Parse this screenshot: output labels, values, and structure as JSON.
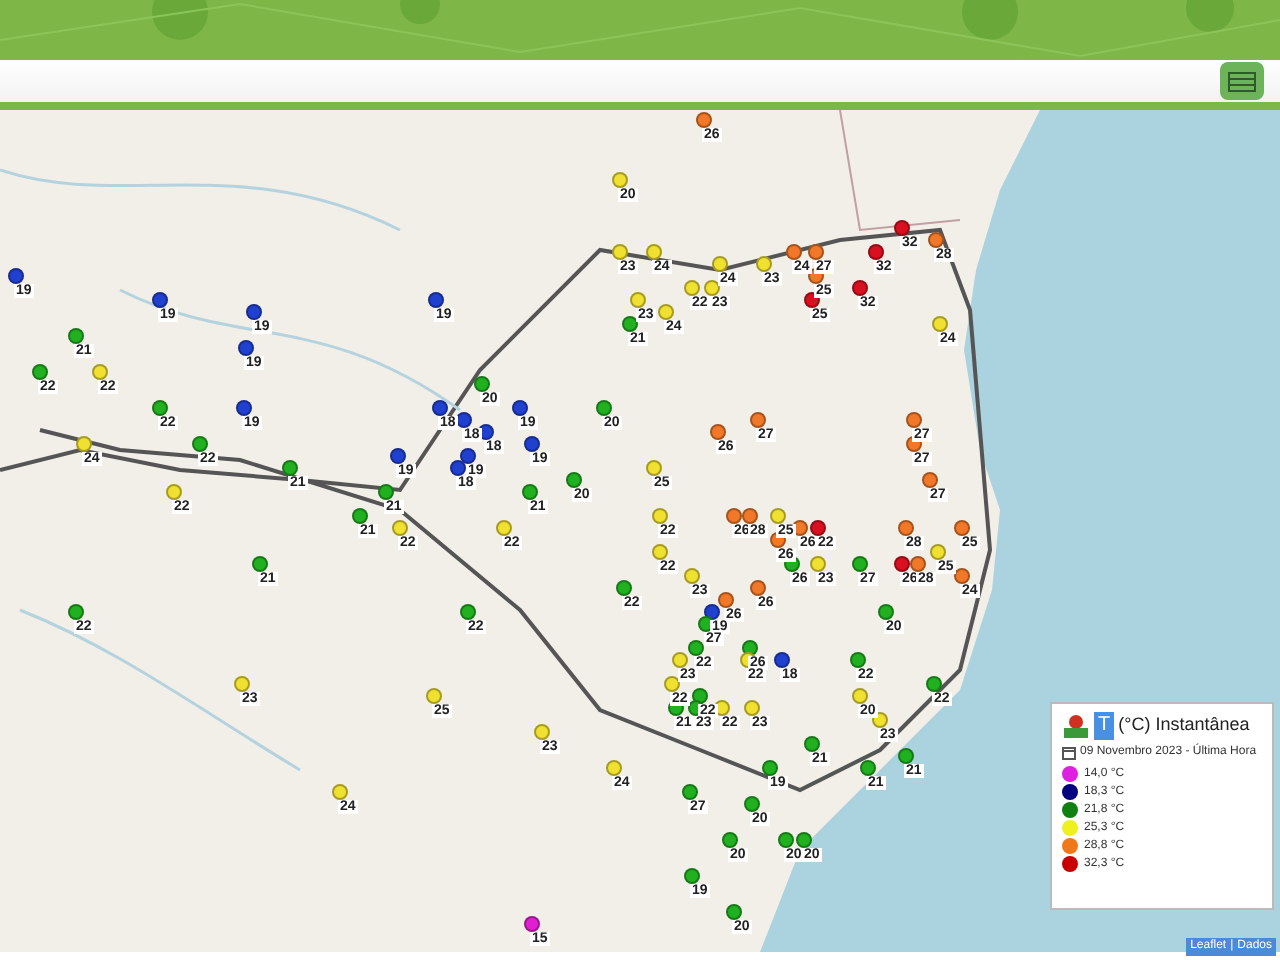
{
  "map": {
    "pins": [
      {
        "value": "26",
        "color": "#f07828"
      },
      {
        "value": "20",
        "color": "#f0e030"
      },
      {
        "value": "32",
        "color": "#d81020"
      },
      {
        "value": "28",
        "color": "#f07828"
      },
      {
        "value": "23",
        "color": "#f0e030"
      },
      {
        "value": "24",
        "color": "#f0e030"
      },
      {
        "value": "24",
        "color": "#f07828"
      },
      {
        "value": "27",
        "color": "#f07828"
      },
      {
        "value": "32",
        "color": "#d81020"
      },
      {
        "value": "24",
        "color": "#f0e030"
      },
      {
        "value": "23",
        "color": "#f0e030"
      },
      {
        "value": "19",
        "color": "#2040d0"
      },
      {
        "value": "25",
        "color": "#f07828"
      },
      {
        "value": "22",
        "color": "#f0e030"
      },
      {
        "value": "23",
        "color": "#f0e030"
      },
      {
        "value": "32",
        "color": "#d81020"
      },
      {
        "value": "19",
        "color": "#2040d0"
      },
      {
        "value": "19",
        "color": "#2040d0"
      },
      {
        "value": "23",
        "color": "#f0e030"
      },
      {
        "value": "25",
        "color": "#d81020"
      },
      {
        "value": "19",
        "color": "#2040d0"
      },
      {
        "value": "24",
        "color": "#f0e030"
      },
      {
        "value": "21",
        "color": "#20b020"
      },
      {
        "value": "24",
        "color": "#f0e030"
      },
      {
        "value": "21",
        "color": "#20b020"
      },
      {
        "value": "19",
        "color": "#2040d0"
      },
      {
        "value": "22",
        "color": "#20b020"
      },
      {
        "value": "22",
        "color": "#f0e030"
      },
      {
        "value": "20",
        "color": "#20b020"
      },
      {
        "value": "22",
        "color": "#20b020"
      },
      {
        "value": "19",
        "color": "#2040d0"
      },
      {
        "value": "18",
        "color": "#2040d0"
      },
      {
        "value": "19",
        "color": "#2040d0"
      },
      {
        "value": "20",
        "color": "#20b020"
      },
      {
        "value": "18",
        "color": "#2040d0"
      },
      {
        "value": "27",
        "color": "#f07828"
      },
      {
        "value": "27",
        "color": "#f07828"
      },
      {
        "value": "18",
        "color": "#2040d0"
      },
      {
        "value": "26",
        "color": "#f07828"
      },
      {
        "value": "24",
        "color": "#f0e030"
      },
      {
        "value": "22",
        "color": "#20b020"
      },
      {
        "value": "19",
        "color": "#2040d0"
      },
      {
        "value": "27",
        "color": "#f07828"
      },
      {
        "value": "19",
        "color": "#2040d0"
      },
      {
        "value": "19",
        "color": "#2040d0"
      },
      {
        "value": "21",
        "color": "#20b020"
      },
      {
        "value": "18",
        "color": "#2040d0"
      },
      {
        "value": "25",
        "color": "#f0e030"
      },
      {
        "value": "20",
        "color": "#20b020"
      },
      {
        "value": "27",
        "color": "#f07828"
      },
      {
        "value": "22",
        "color": "#f0e030"
      },
      {
        "value": "21",
        "color": "#20b020"
      },
      {
        "value": "21",
        "color": "#20b020"
      },
      {
        "value": "21",
        "color": "#20b020"
      },
      {
        "value": "22",
        "color": "#f0e030"
      },
      {
        "value": "26",
        "color": "#f07828"
      },
      {
        "value": "28",
        "color": "#f07828"
      },
      {
        "value": "25",
        "color": "#f0e030"
      },
      {
        "value": "22",
        "color": "#f0e030"
      },
      {
        "value": "22",
        "color": "#f0e030"
      },
      {
        "value": "26",
        "color": "#f07828"
      },
      {
        "value": "22",
        "color": "#d81020"
      },
      {
        "value": "28",
        "color": "#f07828"
      },
      {
        "value": "25",
        "color": "#f07828"
      },
      {
        "value": "26",
        "color": "#f07828"
      },
      {
        "value": "22",
        "color": "#f0e030"
      },
      {
        "value": "25",
        "color": "#f0e030"
      },
      {
        "value": "21",
        "color": "#20b020"
      },
      {
        "value": "26",
        "color": "#20b020"
      },
      {
        "value": "23",
        "color": "#f0e030"
      },
      {
        "value": "27",
        "color": "#20b020"
      },
      {
        "value": "26",
        "color": "#d81020"
      },
      {
        "value": "28",
        "color": "#f07828"
      },
      {
        "value": "23",
        "color": "#f0e030"
      },
      {
        "value": "24",
        "color": "#f07828"
      },
      {
        "value": "22",
        "color": "#20b020"
      },
      {
        "value": "26",
        "color": "#f07828"
      },
      {
        "value": "26",
        "color": "#f07828"
      },
      {
        "value": "22",
        "color": "#20b020"
      },
      {
        "value": "22",
        "color": "#20b020"
      },
      {
        "value": "19",
        "color": "#2040d0"
      },
      {
        "value": "20",
        "color": "#20b020"
      },
      {
        "value": "27",
        "color": "#20b020"
      },
      {
        "value": "22",
        "color": "#20b020"
      },
      {
        "value": "26",
        "color": "#20b020"
      },
      {
        "value": "23",
        "color": "#f0e030"
      },
      {
        "value": "22",
        "color": "#f0e030"
      },
      {
        "value": "18",
        "color": "#2040d0"
      },
      {
        "value": "22",
        "color": "#20b020"
      },
      {
        "value": "23",
        "color": "#f0e030"
      },
      {
        "value": "22",
        "color": "#f0e030"
      },
      {
        "value": "22",
        "color": "#20b020"
      },
      {
        "value": "25",
        "color": "#f0e030"
      },
      {
        "value": "22",
        "color": "#20b020"
      },
      {
        "value": "20",
        "color": "#f0e030"
      },
      {
        "value": "21",
        "color": "#20b020"
      },
      {
        "value": "23",
        "color": "#20b020"
      },
      {
        "value": "22",
        "color": "#f0e030"
      },
      {
        "value": "23",
        "color": "#f0e030"
      },
      {
        "value": "23",
        "color": "#f0e030"
      },
      {
        "value": "23",
        "color": "#f0e030"
      },
      {
        "value": "21",
        "color": "#20b020"
      },
      {
        "value": "21",
        "color": "#20b020"
      },
      {
        "value": "24",
        "color": "#f0e030"
      },
      {
        "value": "19",
        "color": "#20b020"
      },
      {
        "value": "21",
        "color": "#20b020"
      },
      {
        "value": "24",
        "color": "#f0e030"
      },
      {
        "value": "27",
        "color": "#20b020"
      },
      {
        "value": "20",
        "color": "#20b020"
      },
      {
        "value": "20",
        "color": "#20b020"
      },
      {
        "value": "20",
        "color": "#20b020"
      },
      {
        "value": "20",
        "color": "#20b020"
      },
      {
        "value": "19",
        "color": "#20b020"
      },
      {
        "value": "20",
        "color": "#20b020"
      },
      {
        "value": "15",
        "color": "#e020d0"
      }
    ]
  },
  "legend": {
    "badge": "T",
    "title": "(°C) Instantânea",
    "date": "09 Novembro 2023 - Última Hora",
    "items": [
      {
        "label": "14,0 °C",
        "color": "#e020e0"
      },
      {
        "label": "18,3 °C",
        "color": "#000080"
      },
      {
        "label": "21,8 °C",
        "color": "#108010"
      },
      {
        "label": "25,3 °C",
        "color": "#f0f020"
      },
      {
        "label": "28,8 °C",
        "color": "#f07818"
      },
      {
        "label": "32,3 °C",
        "color": "#c80000"
      }
    ]
  },
  "attribution": {
    "link": "Leaflet",
    "separator": "|",
    "source": "Dados"
  }
}
